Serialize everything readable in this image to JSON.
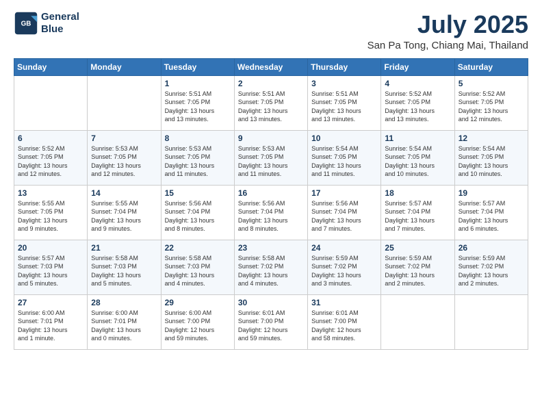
{
  "header": {
    "logo_line1": "General",
    "logo_line2": "Blue",
    "month": "July 2025",
    "location": "San Pa Tong, Chiang Mai, Thailand"
  },
  "days_of_week": [
    "Sunday",
    "Monday",
    "Tuesday",
    "Wednesday",
    "Thursday",
    "Friday",
    "Saturday"
  ],
  "weeks": [
    [
      {
        "day": "",
        "info": ""
      },
      {
        "day": "",
        "info": ""
      },
      {
        "day": "1",
        "info": "Sunrise: 5:51 AM\nSunset: 7:05 PM\nDaylight: 13 hours\nand 13 minutes."
      },
      {
        "day": "2",
        "info": "Sunrise: 5:51 AM\nSunset: 7:05 PM\nDaylight: 13 hours\nand 13 minutes."
      },
      {
        "day": "3",
        "info": "Sunrise: 5:51 AM\nSunset: 7:05 PM\nDaylight: 13 hours\nand 13 minutes."
      },
      {
        "day": "4",
        "info": "Sunrise: 5:52 AM\nSunset: 7:05 PM\nDaylight: 13 hours\nand 13 minutes."
      },
      {
        "day": "5",
        "info": "Sunrise: 5:52 AM\nSunset: 7:05 PM\nDaylight: 13 hours\nand 12 minutes."
      }
    ],
    [
      {
        "day": "6",
        "info": "Sunrise: 5:52 AM\nSunset: 7:05 PM\nDaylight: 13 hours\nand 12 minutes."
      },
      {
        "day": "7",
        "info": "Sunrise: 5:53 AM\nSunset: 7:05 PM\nDaylight: 13 hours\nand 12 minutes."
      },
      {
        "day": "8",
        "info": "Sunrise: 5:53 AM\nSunset: 7:05 PM\nDaylight: 13 hours\nand 11 minutes."
      },
      {
        "day": "9",
        "info": "Sunrise: 5:53 AM\nSunset: 7:05 PM\nDaylight: 13 hours\nand 11 minutes."
      },
      {
        "day": "10",
        "info": "Sunrise: 5:54 AM\nSunset: 7:05 PM\nDaylight: 13 hours\nand 11 minutes."
      },
      {
        "day": "11",
        "info": "Sunrise: 5:54 AM\nSunset: 7:05 PM\nDaylight: 13 hours\nand 10 minutes."
      },
      {
        "day": "12",
        "info": "Sunrise: 5:54 AM\nSunset: 7:05 PM\nDaylight: 13 hours\nand 10 minutes."
      }
    ],
    [
      {
        "day": "13",
        "info": "Sunrise: 5:55 AM\nSunset: 7:05 PM\nDaylight: 13 hours\nand 9 minutes."
      },
      {
        "day": "14",
        "info": "Sunrise: 5:55 AM\nSunset: 7:04 PM\nDaylight: 13 hours\nand 9 minutes."
      },
      {
        "day": "15",
        "info": "Sunrise: 5:56 AM\nSunset: 7:04 PM\nDaylight: 13 hours\nand 8 minutes."
      },
      {
        "day": "16",
        "info": "Sunrise: 5:56 AM\nSunset: 7:04 PM\nDaylight: 13 hours\nand 8 minutes."
      },
      {
        "day": "17",
        "info": "Sunrise: 5:56 AM\nSunset: 7:04 PM\nDaylight: 13 hours\nand 7 minutes."
      },
      {
        "day": "18",
        "info": "Sunrise: 5:57 AM\nSunset: 7:04 PM\nDaylight: 13 hours\nand 7 minutes."
      },
      {
        "day": "19",
        "info": "Sunrise: 5:57 AM\nSunset: 7:04 PM\nDaylight: 13 hours\nand 6 minutes."
      }
    ],
    [
      {
        "day": "20",
        "info": "Sunrise: 5:57 AM\nSunset: 7:03 PM\nDaylight: 13 hours\nand 5 minutes."
      },
      {
        "day": "21",
        "info": "Sunrise: 5:58 AM\nSunset: 7:03 PM\nDaylight: 13 hours\nand 5 minutes."
      },
      {
        "day": "22",
        "info": "Sunrise: 5:58 AM\nSunset: 7:03 PM\nDaylight: 13 hours\nand 4 minutes."
      },
      {
        "day": "23",
        "info": "Sunrise: 5:58 AM\nSunset: 7:02 PM\nDaylight: 13 hours\nand 4 minutes."
      },
      {
        "day": "24",
        "info": "Sunrise: 5:59 AM\nSunset: 7:02 PM\nDaylight: 13 hours\nand 3 minutes."
      },
      {
        "day": "25",
        "info": "Sunrise: 5:59 AM\nSunset: 7:02 PM\nDaylight: 13 hours\nand 2 minutes."
      },
      {
        "day": "26",
        "info": "Sunrise: 5:59 AM\nSunset: 7:02 PM\nDaylight: 13 hours\nand 2 minutes."
      }
    ],
    [
      {
        "day": "27",
        "info": "Sunrise: 6:00 AM\nSunset: 7:01 PM\nDaylight: 13 hours\nand 1 minute."
      },
      {
        "day": "28",
        "info": "Sunrise: 6:00 AM\nSunset: 7:01 PM\nDaylight: 13 hours\nand 0 minutes."
      },
      {
        "day": "29",
        "info": "Sunrise: 6:00 AM\nSunset: 7:00 PM\nDaylight: 12 hours\nand 59 minutes."
      },
      {
        "day": "30",
        "info": "Sunrise: 6:01 AM\nSunset: 7:00 PM\nDaylight: 12 hours\nand 59 minutes."
      },
      {
        "day": "31",
        "info": "Sunrise: 6:01 AM\nSunset: 7:00 PM\nDaylight: 12 hours\nand 58 minutes."
      },
      {
        "day": "",
        "info": ""
      },
      {
        "day": "",
        "info": ""
      }
    ]
  ]
}
